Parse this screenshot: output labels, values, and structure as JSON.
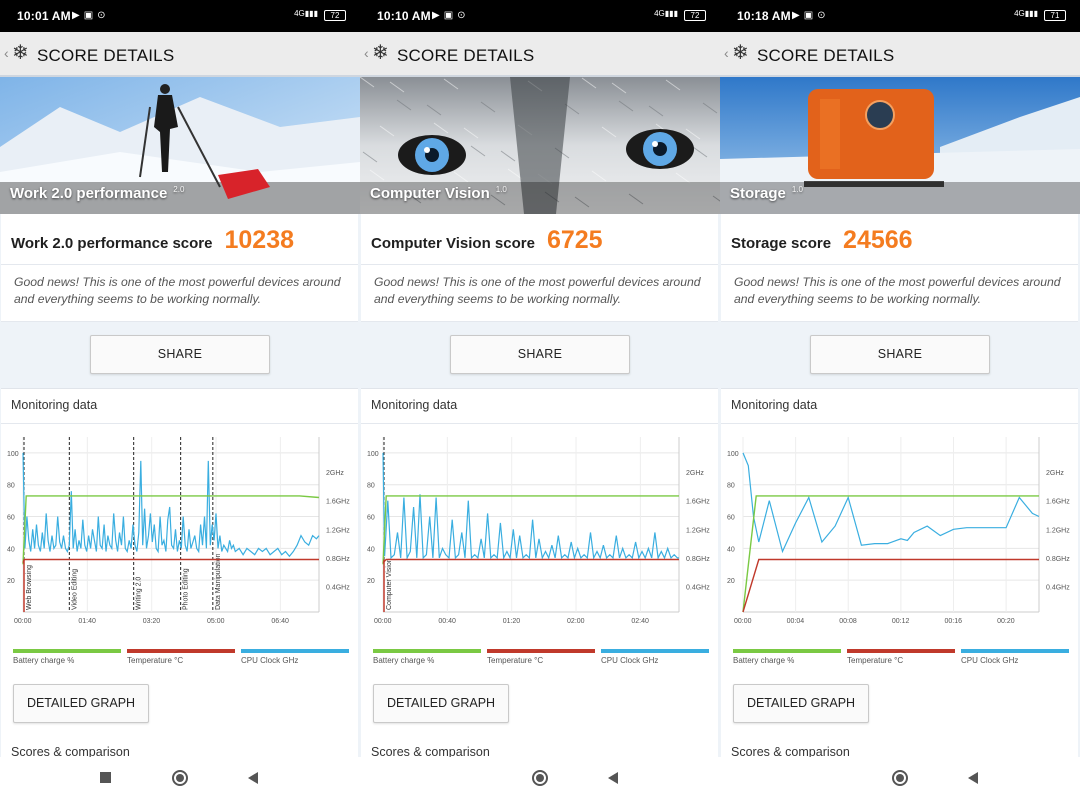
{
  "panels": [
    {
      "status": {
        "time": "10:01 AM",
        "battery": "72",
        "network": "4G"
      },
      "header_title": "SCORE DETAILS",
      "hero_label": "Work 2.0 performance",
      "hero_version": "2.0",
      "score_label": "Work 2.0 performance score",
      "score_value": "10238",
      "message": "Good news! This is one of the most powerful devices around and everything seems to be working normally.",
      "share_label": "SHARE",
      "monitoring_title": "Monitoring data",
      "legend": [
        "Battery charge %",
        "Temperature °C",
        "CPU Clock GHz"
      ],
      "detailed_label": "DETAILED GRAPH",
      "scores_label": "Scores & comparison"
    },
    {
      "status": {
        "time": "10:10 AM",
        "battery": "72",
        "network": "4G"
      },
      "header_title": "SCORE DETAILS",
      "hero_label": "Computer Vision",
      "hero_version": "1.0",
      "score_label": "Computer Vision score",
      "score_value": "6725",
      "message": "Good news! This is one of the most powerful devices around and everything seems to be working normally.",
      "share_label": "SHARE",
      "monitoring_title": "Monitoring data",
      "legend": [
        "Battery charge %",
        "Temperature °C",
        "CPU Clock GHz"
      ],
      "detailed_label": "DETAILED GRAPH",
      "scores_label": "Scores & comparison"
    },
    {
      "status": {
        "time": "10:18 AM",
        "battery": "71",
        "network": "4G"
      },
      "header_title": "SCORE DETAILS",
      "hero_label": "Storage",
      "hero_version": "1.0",
      "score_label": "Storage score",
      "score_value": "24566",
      "message": "Good news! This is one of the most powerful devices around and everything seems to be working normally.",
      "share_label": "SHARE",
      "monitoring_title": "Monitoring data",
      "legend": [
        "Battery charge %",
        "Temperature °C",
        "CPU Clock GHz"
      ],
      "detailed_label": "DETAILED GRAPH",
      "scores_label": "Scores & comparison"
    }
  ],
  "colors": {
    "accent": "#f47c20",
    "battery": "#7ac943",
    "temperature": "#c0392b",
    "cpu": "#3aaee0"
  },
  "icons": [
    "status-play-icon",
    "gallery-icon",
    "location-icon",
    "signal-icon",
    "battery-icon",
    "snowflake-logo-icon",
    "back-chevron-icon",
    "nav-stop-icon",
    "nav-home-icon",
    "nav-back-icon"
  ],
  "chart_data": [
    {
      "type": "line",
      "title": "Monitoring data",
      "y_left_ticks": [
        "100",
        "80",
        "60",
        "40",
        "20"
      ],
      "y_right_ticks": [
        "2GHz",
        "1.6GHz",
        "1.2GHz",
        "0.8GHz",
        "0.4GHz"
      ],
      "x_ticks": [
        "00:00",
        "01:40",
        "03:20",
        "05:00",
        "06:40"
      ],
      "x_range_minutes": [
        0,
        460
      ],
      "phases": [
        {
          "label": "Web Browsing",
          "t": 0
        },
        {
          "label": "Video Editing",
          "t": 72
        },
        {
          "label": "Writing 2.0",
          "t": 172
        },
        {
          "label": "Photo Editing",
          "t": 245
        },
        {
          "label": "Data Manipulation",
          "t": 295
        }
      ],
      "series": [
        {
          "name": "Battery charge %",
          "t": [
            0,
            5,
            430,
            460
          ],
          "values": [
            30,
            73,
            73,
            72
          ]
        },
        {
          "name": "Temperature °C",
          "t": [
            0,
            2,
            460
          ],
          "values": [
            31,
            33,
            33
          ]
        },
        {
          "name": "CPU Clock GHz",
          "t": [
            0,
            3,
            6,
            9,
            12,
            15,
            18,
            21,
            24,
            27,
            30,
            33,
            36,
            39,
            42,
            45,
            48,
            51,
            54,
            57,
            60,
            63,
            66,
            69,
            72,
            75,
            78,
            81,
            84,
            87,
            90,
            93,
            96,
            99,
            102,
            105,
            108,
            111,
            114,
            117,
            120,
            123,
            126,
            129,
            132,
            135,
            138,
            141,
            144,
            147,
            150,
            153,
            156,
            159,
            162,
            165,
            168,
            171,
            174,
            177,
            180,
            183,
            186,
            189,
            192,
            195,
            198,
            201,
            204,
            207,
            210,
            213,
            216,
            219,
            222,
            225,
            228,
            231,
            234,
            237,
            240,
            243,
            246,
            249,
            252,
            255,
            258,
            261,
            264,
            267,
            270,
            273,
            276,
            279,
            282,
            285,
            288,
            291,
            294,
            297,
            300,
            303,
            306,
            309,
            312,
            315,
            318,
            321,
            324,
            327,
            330,
            336,
            342,
            348,
            354,
            360,
            366,
            372,
            378,
            384,
            390,
            396,
            402,
            408,
            414,
            420,
            426,
            432,
            438,
            444,
            450,
            456,
            460
          ],
          "values": [
            100,
            40,
            60,
            45,
            38,
            52,
            40,
            55,
            42,
            38,
            50,
            40,
            62,
            45,
            38,
            48,
            40,
            42,
            60,
            44,
            40,
            48,
            40,
            38,
            42,
            76,
            40,
            52,
            38,
            45,
            40,
            58,
            42,
            38,
            48,
            40,
            52,
            45,
            38,
            60,
            42,
            40,
            55,
            38,
            48,
            42,
            40,
            62,
            45,
            38,
            50,
            42,
            60,
            40,
            38,
            45,
            40,
            55,
            42,
            38,
            50,
            95,
            42,
            65,
            40,
            48,
            62,
            44,
            55,
            40,
            38,
            60,
            42,
            45,
            38,
            58,
            66,
            42,
            40,
            52,
            38,
            45,
            40,
            60,
            42,
            38,
            52,
            40,
            44,
            48,
            40,
            38,
            55,
            42,
            60,
            40,
            95,
            42,
            55,
            45,
            62,
            40,
            48,
            38,
            42,
            40,
            38,
            45,
            40,
            42,
            38,
            40,
            36,
            40,
            38,
            36,
            40,
            38,
            40,
            36,
            38,
            40,
            36,
            38,
            35,
            38,
            42,
            48,
            44,
            42,
            48,
            46,
            48
          ]
        }
      ]
    },
    {
      "type": "line",
      "title": "Monitoring data",
      "y_left_ticks": [
        "100",
        "80",
        "60",
        "40",
        "20"
      ],
      "y_right_ticks": [
        "2GHz",
        "1.6GHz",
        "1.2GHz",
        "0.8GHz",
        "0.4GHz"
      ],
      "x_ticks": [
        "00:00",
        "00:40",
        "01:20",
        "02:00",
        "02:40"
      ],
      "x_range_minutes": [
        0,
        184
      ],
      "phases": [
        {
          "label": "Computer Vision",
          "t": 0
        }
      ],
      "series": [
        {
          "name": "Battery charge %",
          "t": [
            0,
            2,
            184
          ],
          "values": [
            30,
            73,
            73
          ]
        },
        {
          "name": "Temperature °C",
          "t": [
            0,
            2,
            184
          ],
          "values": [
            31,
            33,
            33
          ]
        },
        {
          "name": "CPU Clock GHz",
          "t": [
            0,
            1,
            3,
            5,
            7,
            9,
            11,
            13,
            15,
            17,
            19,
            21,
            23,
            25,
            27,
            29,
            31,
            33,
            35,
            37,
            39,
            41,
            43,
            45,
            47,
            49,
            51,
            53,
            55,
            57,
            59,
            61,
            63,
            65,
            67,
            69,
            71,
            73,
            75,
            77,
            79,
            81,
            83,
            85,
            87,
            89,
            91,
            93,
            95,
            97,
            99,
            101,
            103,
            105,
            107,
            109,
            111,
            113,
            115,
            117,
            119,
            121,
            123,
            125,
            127,
            129,
            131,
            133,
            135,
            137,
            139,
            141,
            143,
            145,
            147,
            149,
            151,
            153,
            155,
            157,
            159,
            161,
            163,
            165,
            167,
            169,
            171,
            173,
            175,
            177,
            179,
            181,
            183,
            184
          ],
          "values": [
            100,
            35,
            70,
            34,
            36,
            50,
            34,
            72,
            34,
            38,
            66,
            34,
            74,
            34,
            36,
            60,
            34,
            72,
            34,
            40,
            36,
            34,
            58,
            34,
            36,
            50,
            34,
            70,
            34,
            36,
            34,
            46,
            34,
            62,
            34,
            36,
            34,
            56,
            34,
            38,
            34,
            52,
            34,
            48,
            34,
            36,
            34,
            58,
            34,
            46,
            34,
            38,
            34,
            42,
            34,
            48,
            34,
            36,
            34,
            44,
            34,
            40,
            34,
            36,
            34,
            50,
            34,
            38,
            34,
            42,
            34,
            36,
            34,
            48,
            34,
            40,
            34,
            36,
            34,
            44,
            34,
            38,
            34,
            40,
            34,
            50,
            34,
            38,
            34,
            40,
            34,
            36,
            34,
            34
          ]
        }
      ]
    },
    {
      "type": "line",
      "title": "Monitoring data",
      "y_left_ticks": [
        "100",
        "80",
        "60",
        "40",
        "20"
      ],
      "y_right_ticks": [
        "2GHz",
        "1.6GHz",
        "1.2GHz",
        "0.8GHz",
        "0.4GHz"
      ],
      "x_ticks": [
        "00:00",
        "00:04",
        "00:08",
        "00:12",
        "00:16",
        "00:20"
      ],
      "x_range_minutes": [
        0,
        22.5
      ],
      "phases": [],
      "series": [
        {
          "name": "Battery charge %",
          "t": [
            0,
            1,
            22.5
          ],
          "values": [
            0,
            73,
            73
          ]
        },
        {
          "name": "Temperature °C",
          "t": [
            0,
            1.2,
            22.5
          ],
          "values": [
            0,
            33,
            33
          ]
        },
        {
          "name": "CPU Clock GHz",
          "t": [
            0,
            0.4,
            0.8,
            1.2,
            2.0,
            3.0,
            4.0,
            5.0,
            6.0,
            7.0,
            8.0,
            9.0,
            10.0,
            11.0,
            12.0,
            12.5,
            13.0,
            14.0,
            15.0,
            16.0,
            17.0,
            18.0,
            19.0,
            20.0,
            21.0,
            22.0,
            22.5
          ],
          "values": [
            100,
            92,
            60,
            44,
            70,
            38,
            56,
            72,
            44,
            54,
            72,
            42,
            43,
            43,
            46,
            45,
            50,
            54,
            48,
            52,
            53,
            53,
            53,
            53,
            72,
            62,
            60
          ]
        }
      ]
    }
  ]
}
